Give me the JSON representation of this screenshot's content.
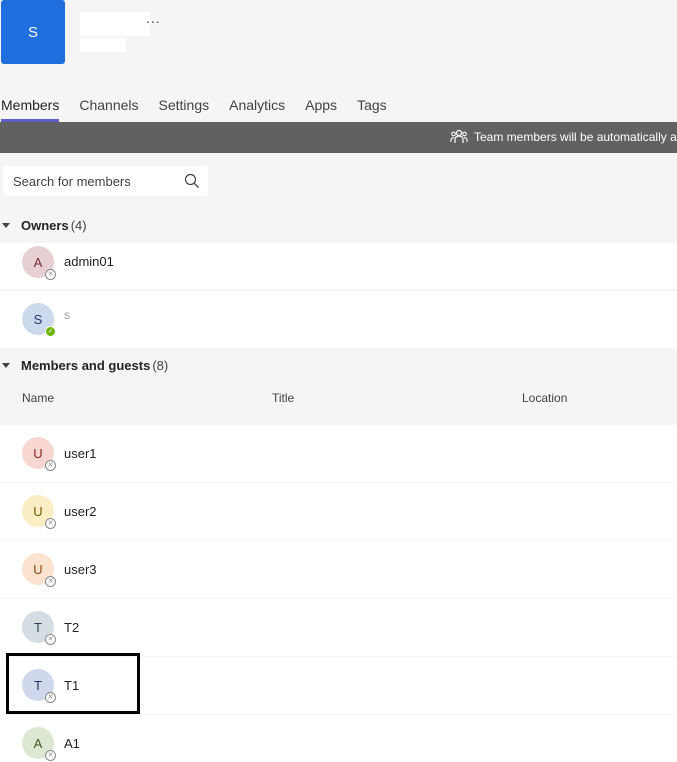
{
  "team": {
    "avatar_letter": "S",
    "name": "",
    "subtitle": "",
    "more_label": "..."
  },
  "tabs": [
    {
      "label": "Members",
      "active": true
    },
    {
      "label": "Channels"
    },
    {
      "label": "Settings"
    },
    {
      "label": "Analytics"
    },
    {
      "label": "Apps"
    },
    {
      "label": "Tags"
    }
  ],
  "banner": {
    "icon": "people-group-icon",
    "text": "Team members will be automatically ac"
  },
  "search": {
    "placeholder": "Search for members",
    "icon": "search-icon"
  },
  "owners": {
    "title": "Owners",
    "count": "(4)",
    "members": [
      {
        "initial": "A",
        "name": "admin01",
        "avatar_color": "#e6d0d3",
        "status": "offline"
      },
      {
        "initial": "S",
        "name": "S",
        "avatar_color": "#cdd9ec",
        "status": "available"
      }
    ]
  },
  "guests": {
    "title": "Members and guests",
    "count": "(8)",
    "columns": {
      "name": "Name",
      "title": "Title",
      "location": "Location"
    },
    "members": [
      {
        "initial": "U",
        "name": "user1",
        "avatar_color": "#f8d7d3",
        "status": "offline"
      },
      {
        "initial": "U",
        "name": "user2",
        "avatar_color": "#fbeec5",
        "status": "offline"
      },
      {
        "initial": "U",
        "name": "user3",
        "avatar_color": "#fbe3cf",
        "status": "offline"
      },
      {
        "initial": "T",
        "name": "T2",
        "avatar_color": "#d4dde1",
        "status": "offline"
      },
      {
        "initial": "T",
        "name": "T1",
        "avatar_color": "#cfd8ec",
        "status": "offline"
      },
      {
        "initial": "A",
        "name": "A1",
        "avatar_color": "#dde8d3",
        "status": "offline"
      }
    ]
  },
  "colors": {
    "accent": "#5b5fc7",
    "team_tile": "#1f6fde",
    "banner": "#616161",
    "available": "#6bb700"
  }
}
